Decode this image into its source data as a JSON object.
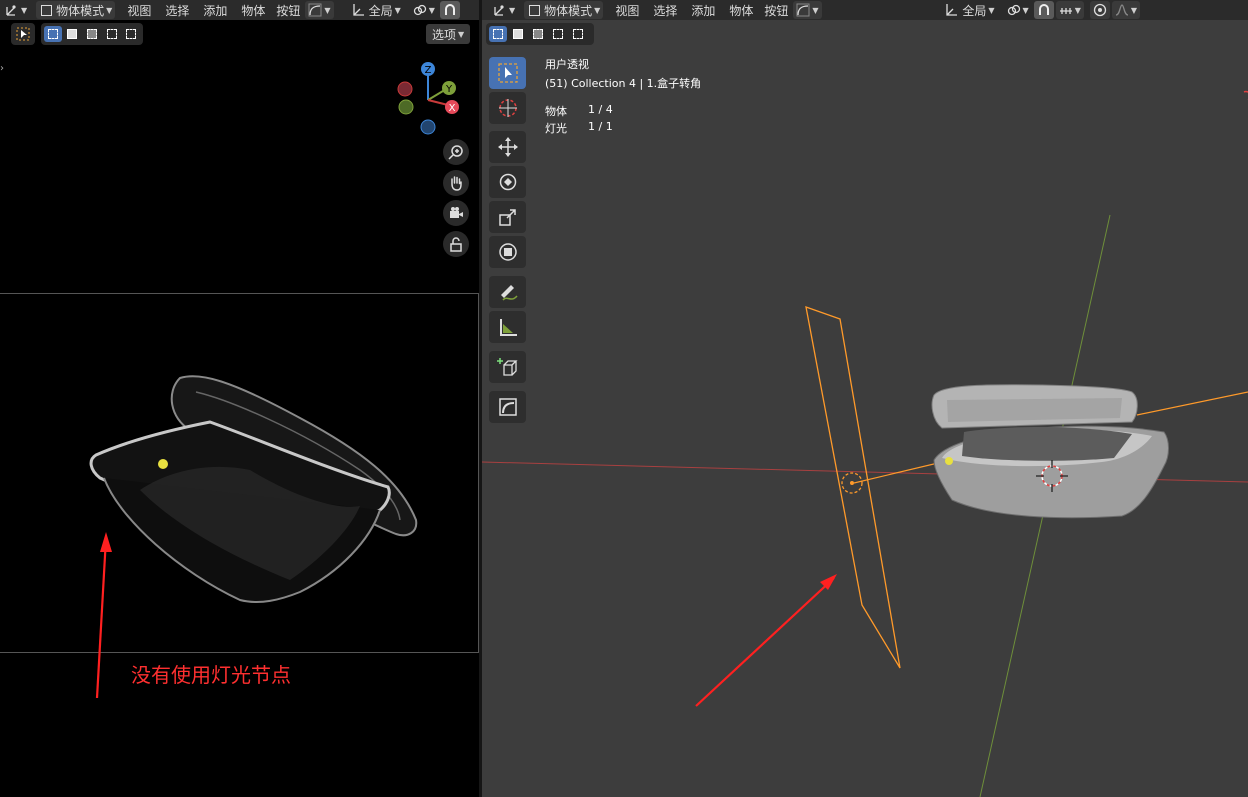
{
  "left_header": {
    "mode_label": "物体模式",
    "menus": [
      "视图",
      "选择",
      "添加",
      "物体",
      "按钮"
    ],
    "transform_label": "全局",
    "options_label": "选项"
  },
  "right_header": {
    "mode_label": "物体模式",
    "menus": [
      "视图",
      "选择",
      "添加",
      "物体",
      "按钮"
    ],
    "transform_label": "全局"
  },
  "viewport_info": {
    "view_name": "用户透视",
    "collection_line": "(51) Collection 4 | 1.盒子转角",
    "stats": [
      {
        "label": "物体",
        "value": "1 / 4"
      },
      {
        "label": "灯光",
        "value": "1 / 1"
      }
    ]
  },
  "gizmo": {
    "x_label": "X",
    "y_label": "Y",
    "z_label": "Z"
  },
  "annotation": {
    "text": "没有使用灯光节点",
    "color": "#ff3030"
  },
  "colors": {
    "accent": "#4772b3",
    "selected_outline": "#ff9a2a",
    "x_axis": "#c83a3a",
    "y_axis": "#7ea03a",
    "z_axis": "#3d86d9"
  }
}
